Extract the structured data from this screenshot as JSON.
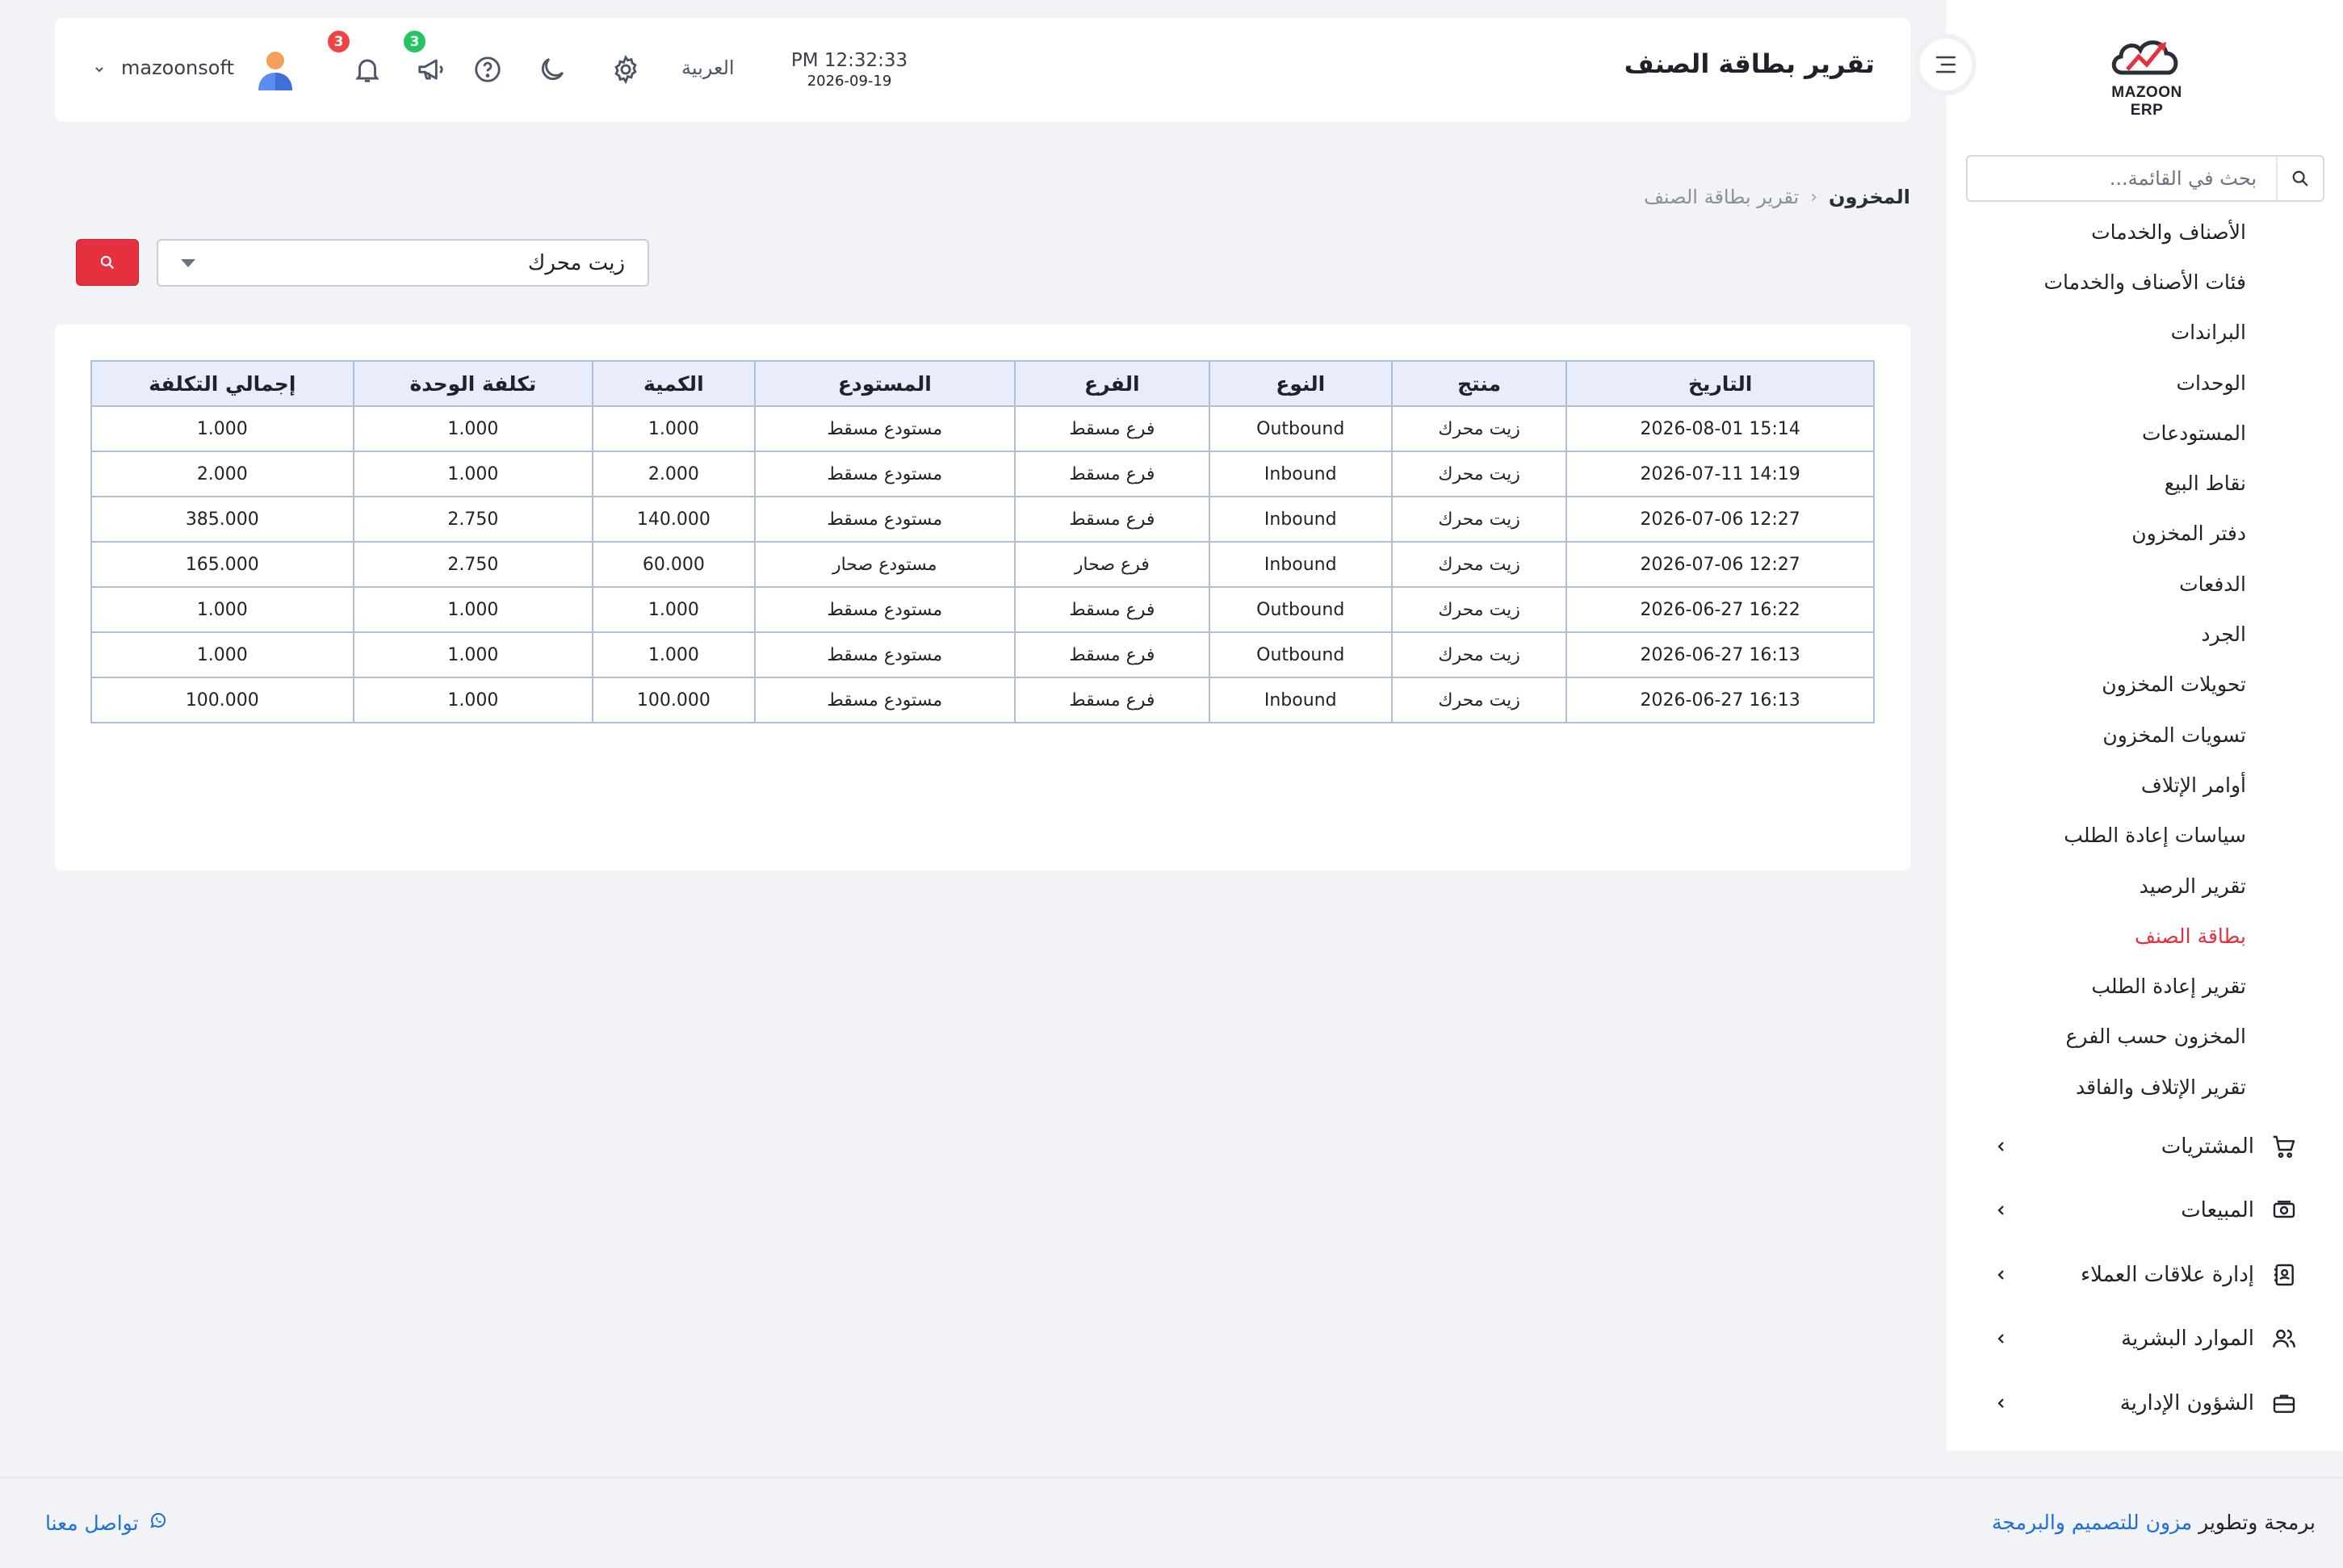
{
  "brand": {
    "name": "MAZOON ERP",
    "colors": {
      "accent": "#e5303f",
      "link": "#1e6fd9"
    }
  },
  "sidebar": {
    "search_placeholder": "بحث في القائمة...",
    "items": [
      {
        "label": "الأصناف والخدمات"
      },
      {
        "label": "فئات الأصناف والخدمات"
      },
      {
        "label": "البراندات"
      },
      {
        "label": "الوحدات"
      },
      {
        "label": "المستودعات"
      },
      {
        "label": "نقاط البيع"
      },
      {
        "label": "دفتر المخزون"
      },
      {
        "label": "الدفعات"
      },
      {
        "label": "الجرد"
      },
      {
        "label": "تحويلات المخزون"
      },
      {
        "label": "تسويات المخزون"
      },
      {
        "label": "أوامر الإتلاف"
      },
      {
        "label": "سياسات إعادة الطلب"
      },
      {
        "label": "تقرير الرصيد"
      },
      {
        "label": "بطاقة الصنف",
        "active": true
      },
      {
        "label": "تقرير إعادة الطلب"
      },
      {
        "label": "المخزون حسب الفرع"
      },
      {
        "label": "تقرير الإتلاف والفاقد"
      }
    ],
    "groups": [
      {
        "label": "المشتريات",
        "icon": "cart-icon"
      },
      {
        "label": "المبيعات",
        "icon": "cash-icon"
      },
      {
        "label": "إدارة علاقات العملاء",
        "icon": "contacts-icon"
      },
      {
        "label": "الموارد البشرية",
        "icon": "users-icon"
      },
      {
        "label": "الشؤون الإدارية",
        "icon": "briefcase-icon"
      }
    ]
  },
  "header": {
    "title": "تقرير بطاقة الصنف",
    "time": "PM 12:32:33",
    "date": "2026-09-19",
    "language": "العربية",
    "notifications_count": "3",
    "announcements_count": "3",
    "username": "mazoonsoft"
  },
  "breadcrumb": {
    "home": "المخزون",
    "current": "تقرير بطاقة الصنف"
  },
  "filter": {
    "product": "زيت محرك"
  },
  "table": {
    "headers": [
      "التاريخ",
      "منتج",
      "النوع",
      "الفرع",
      "المستودع",
      "الكمية",
      "تكلفة الوحدة",
      "إجمالي التكلفة"
    ],
    "rows": [
      [
        "15:14 2026-08-01",
        "زيت محرك",
        "Outbound",
        "فرع مسقط",
        "مستودع مسقط",
        "1.000",
        "1.000",
        "1.000"
      ],
      [
        "14:19 2026-07-11",
        "زيت محرك",
        "Inbound",
        "فرع مسقط",
        "مستودع مسقط",
        "2.000",
        "1.000",
        "2.000"
      ],
      [
        "12:27 2026-07-06",
        "زيت محرك",
        "Inbound",
        "فرع مسقط",
        "مستودع مسقط",
        "140.000",
        "2.750",
        "385.000"
      ],
      [
        "12:27 2026-07-06",
        "زيت محرك",
        "Inbound",
        "فرع صحار",
        "مستودع صحار",
        "60.000",
        "2.750",
        "165.000"
      ],
      [
        "16:22 2026-06-27",
        "زيت محرك",
        "Outbound",
        "فرع مسقط",
        "مستودع مسقط",
        "1.000",
        "1.000",
        "1.000"
      ],
      [
        "16:13 2026-06-27",
        "زيت محرك",
        "Outbound",
        "فرع مسقط",
        "مستودع مسقط",
        "1.000",
        "1.000",
        "1.000"
      ],
      [
        "16:13 2026-06-27",
        "زيت محرك",
        "Inbound",
        "فرع مسقط",
        "مستودع مسقط",
        "100.000",
        "1.000",
        "100.000"
      ]
    ]
  },
  "footer": {
    "credit_prefix": "برمجة وتطوير",
    "credit_link": "مزون للتصميم والبرمجة",
    "contact": "تواصل معنا"
  }
}
